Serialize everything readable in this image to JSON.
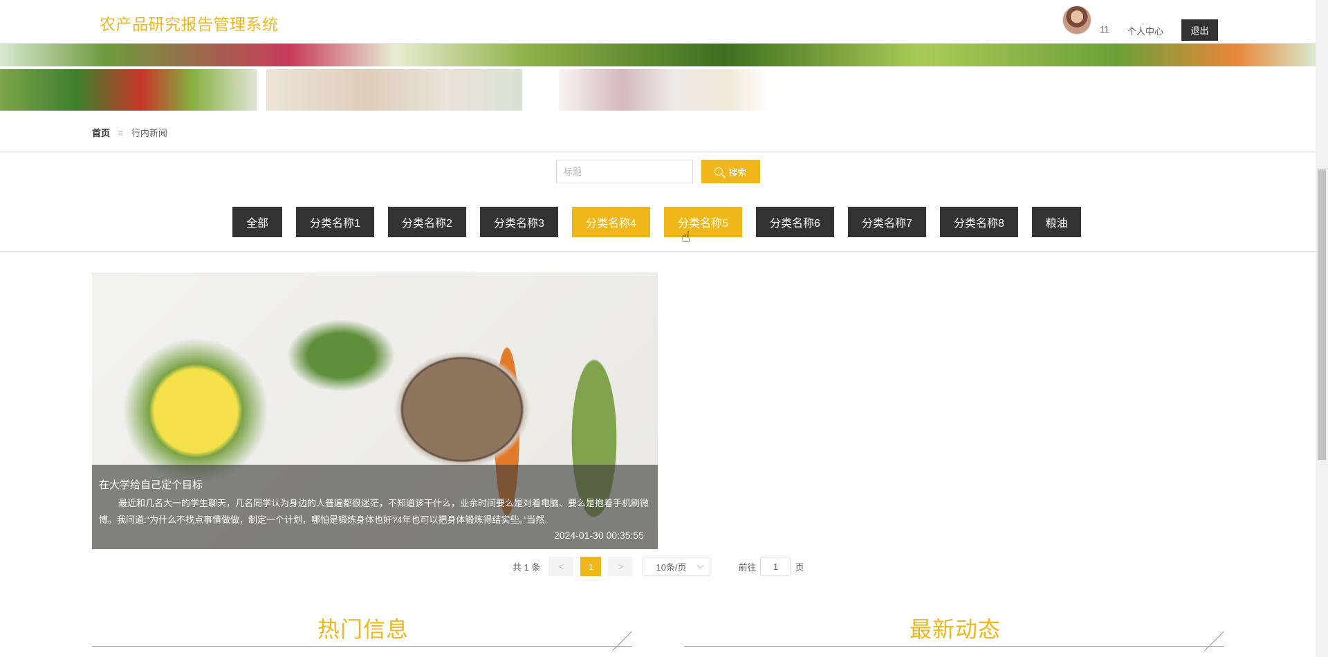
{
  "header": {
    "title": "农产品研究报告管理系统",
    "user_name": "11",
    "user_center": "个人中心",
    "logout": "退出"
  },
  "breadcrumb": {
    "home": "首页",
    "separator": "≡",
    "current": "行内新闻"
  },
  "search": {
    "placeholder": "标题",
    "value": "",
    "button_label": "搜索"
  },
  "categories": [
    {
      "label": "全部",
      "active": false
    },
    {
      "label": "分类名称1",
      "active": false
    },
    {
      "label": "分类名称2",
      "active": false
    },
    {
      "label": "分类名称3",
      "active": false
    },
    {
      "label": "分类名称4",
      "active": true
    },
    {
      "label": "分类名称5",
      "active": true
    },
    {
      "label": "分类名称6",
      "active": false
    },
    {
      "label": "分类名称7",
      "active": false
    },
    {
      "label": "分类名称8",
      "active": false
    },
    {
      "label": "粮油",
      "active": false
    }
  ],
  "news": [
    {
      "title": "在大学给自己定个目标",
      "excerpt": "最近和几名大一的学生聊天，几名同学认为身边的人普遍都很迷茫，不知道该干什么，业余时间要么是对着电脑、要么是抱着手机刷微博。我问道:“为什么不找点事情做做，制定一个计划，哪怕是锻炼身体也好?4年也可以把身体锻炼得结实些。”当然,",
      "date": "2024-01-30 00:35:55"
    }
  ],
  "pagination": {
    "total": "共 1 条",
    "prev": "<",
    "current": "1",
    "next": ">",
    "page_size": "10条/页",
    "goto_label": "前往",
    "goto_value": "1",
    "page_unit": "页"
  },
  "sections": {
    "hot": "热门信息",
    "latest": "最新动态"
  },
  "colors": {
    "accent": "#f0b71a",
    "dark_button": "#333333"
  }
}
